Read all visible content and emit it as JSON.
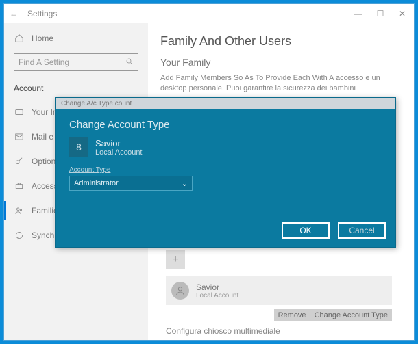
{
  "titlebar": {
    "back": "←",
    "title": "Settings"
  },
  "sidebar": {
    "home": "Home",
    "search_placeholder": "Find A Setting",
    "section": "Account",
    "items": [
      {
        "label": "Your Info"
      },
      {
        "label": "Mail e Account"
      },
      {
        "label": "Option"
      },
      {
        "label": "Access"
      },
      {
        "label": "Families"
      },
      {
        "label": "Synchronize"
      }
    ]
  },
  "main": {
    "heading": "Family And Other Users",
    "subheading": "Your Family",
    "family_text": "Add Family Members So As To Provide Each With A accesso e un desktop personale. Puoi garantire la sicurezza dei bambini",
    "add_plus": "+",
    "user_tile": {
      "name": "Savior",
      "sub": "Local Account",
      "change_btn": "Change Account Type",
      "remove_btn": "Remove"
    },
    "footer": "Configura chiosco multimediale"
  },
  "dialog": {
    "window_title": "Change A/c Type  count",
    "heading": "Change Account Type",
    "avatar_glyph": "8",
    "acct_name": "Savior",
    "acct_sub": "Local Account",
    "field_label": "Account Type",
    "dropdown_value": "Administrator",
    "ok": "OK",
    "cancel": "Cancel"
  }
}
